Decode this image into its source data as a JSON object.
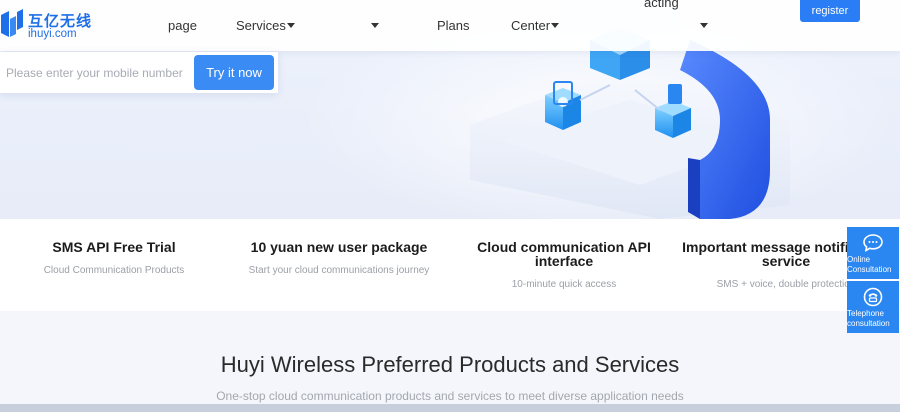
{
  "brand": {
    "name_cn": "互亿无线",
    "domain": "ihuyi.com",
    "color": "#1f6fe8"
  },
  "nav": {
    "items": [
      {
        "label": "page"
      },
      {
        "label": "Services",
        "dropdown": true
      },
      {
        "label": "",
        "dropdown": true
      },
      {
        "label": "Plans"
      },
      {
        "label": "Center",
        "dropdown": true
      },
      {
        "label": "",
        "dropdown": true
      }
    ],
    "acting_label": "acting",
    "register_label": "register"
  },
  "trial": {
    "placeholder": "Please enter your mobile number",
    "button_label": "Try it now"
  },
  "features": [
    {
      "title": "SMS API Free Trial",
      "subtitle": "Cloud Communication Products"
    },
    {
      "title": "10 yuan new user package",
      "subtitle": "Start your cloud communications journey"
    },
    {
      "title": "Cloud communication API interface",
      "subtitle": "10-minute quick access"
    },
    {
      "title": "Important message notification service",
      "subtitle": "SMS + voice, double protection"
    }
  ],
  "section": {
    "title": "Huyi Wireless Preferred Products and Services",
    "subtitle": "One-stop cloud communication products and services to meet diverse application needs"
  },
  "side_buttons": [
    {
      "label": "Online Consultation",
      "icon": "chat-icon"
    },
    {
      "label": "Telephone consultation",
      "icon": "phone-icon"
    }
  ],
  "colors": {
    "accent": "#2a7df5",
    "try_button": "#3a8bf4",
    "side_button": "#2a86f0",
    "hero_bg": "#eaeffb"
  }
}
